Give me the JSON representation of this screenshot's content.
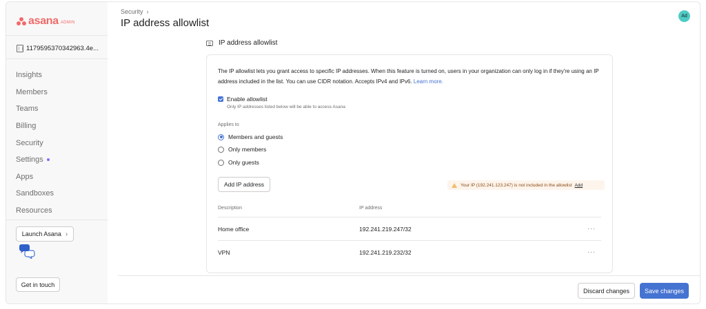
{
  "colors": {
    "brand": "#f06a6a",
    "accent": "#4573d2",
    "sidebar_bg": "#f9f8f8",
    "avatar_bg": "#4ecbc4",
    "warning_bg": "#fdf4ec",
    "warning_icon": "#f1bd6c",
    "settings_dot": "#796eff"
  },
  "sidebar": {
    "logo_text": "asana",
    "logo_badge": "ADMIN",
    "org_icon": "building-icon",
    "org_name": "1179595370342963.4e...",
    "items": [
      {
        "label": "Insights"
      },
      {
        "label": "Members"
      },
      {
        "label": "Teams"
      },
      {
        "label": "Billing"
      },
      {
        "label": "Security"
      },
      {
        "label": "Settings",
        "has_dot": true
      },
      {
        "label": "Apps"
      },
      {
        "label": "Sandboxes"
      },
      {
        "label": "Resources"
      }
    ],
    "launch_label": "Launch Asana",
    "chat_icon": "chat-bubbles-icon",
    "get_in_touch_label": "Get in touch"
  },
  "header": {
    "breadcrumb": "Security",
    "breadcrumb_sep": "›",
    "title": "IP address allowlist",
    "avatar_initials": "Ad"
  },
  "section": {
    "icon": "card-icon",
    "title": "IP address allowlist",
    "description": "The IP allowlist lets you grant access to specific IP addresses. When this feature is turned on, users in your organization can only log in if they're using an IP address included in the list. You can use CIDR notation. Accepts IPv4 and IPv6.",
    "learn_more": "Learn more.",
    "enable_label": "Enable allowlist",
    "enable_checked": true,
    "enable_help": "Only IP addresses listed below will be able to access Asana",
    "applies_to_label": "Applies to",
    "radio_options": [
      {
        "label": "Members and guests",
        "selected": true
      },
      {
        "label": "Only members",
        "selected": false
      },
      {
        "label": "Only guests",
        "selected": false
      }
    ],
    "add_ip_label": "Add IP address",
    "warning_text": "Your IP (192.241.123.247) is not included in the allowlist",
    "warning_action": "Add",
    "columns": [
      "Description",
      "IP address"
    ],
    "rows": [
      {
        "description": "Home office",
        "ip": "192.241.219.247/32",
        "menu": "···"
      },
      {
        "description": "VPN",
        "ip": "192.241.219.232/32",
        "menu": "···"
      }
    ]
  },
  "footer": {
    "discard_label": "Discard changes",
    "save_label": "Save changes"
  }
}
